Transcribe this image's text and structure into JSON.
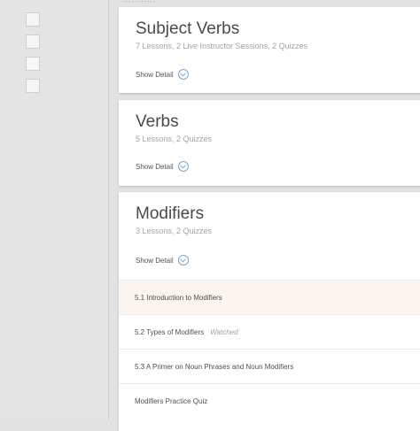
{
  "header": {
    "crumb": "..........."
  },
  "modules": [
    {
      "title": "Subject Verbs",
      "summary": "7 Lessons, 2 Live Instructor Sessions, 2 Quizzes",
      "show_detail": "Show Detail"
    },
    {
      "title": "Verbs",
      "summary": "5 Lessons, 2 Quizzes",
      "show_detail": "Show Detail"
    },
    {
      "title": "Modifiers",
      "summary": "3 Lessons, 2 Quizzes",
      "show_detail": "Show Detail",
      "lessons": [
        {
          "label": "5.1 Introduction to Modifiers",
          "status": ""
        },
        {
          "label": "5.2 Types of Modifiers",
          "status": "Watched"
        },
        {
          "label": "5.3 A Primer on Noun Phrases and Noun Modifiers",
          "status": ""
        },
        {
          "label": "Modifiers Practice Quiz",
          "status": ""
        }
      ]
    }
  ],
  "colors": {
    "accent": "#6fa8d8",
    "active_row": "#fdf3ef"
  }
}
